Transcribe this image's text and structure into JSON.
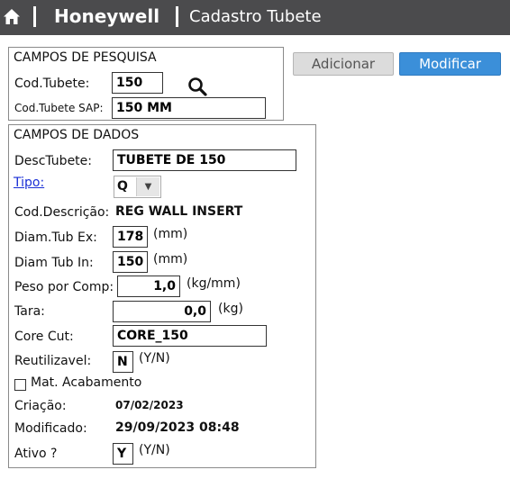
{
  "header": {
    "brand": "Honeywell",
    "title": "Cadastro Tubete",
    "home_icon": "home-icon"
  },
  "toolbar": {
    "add_label": "Adicionar",
    "modify_label": "Modificar"
  },
  "search": {
    "section_title": "CAMPOS DE PESQUISA",
    "cod_tubete_label": "Cod.Tubete:",
    "cod_tubete_value": "150",
    "cod_sap_label": "Cod.Tubete SAP:",
    "cod_sap_value": "150 MM",
    "search_icon": "magnifier-icon"
  },
  "data": {
    "section_title": "CAMPOS DE DADOS",
    "desc_label": "DescTubete:",
    "desc_value": "TUBETE DE 150",
    "tipo_label": "Tipo:",
    "tipo_value": "Q",
    "cod_desc_label": "Cod.Descrição:",
    "cod_desc_value": "REG WALL INSERT",
    "diam_ex_label": "Diam.Tub Ex:",
    "diam_ex_value": "178",
    "diam_ex_unit": "(mm)",
    "diam_in_label": "Diam Tub In:",
    "diam_in_value": "150",
    "diam_in_unit": "(mm)",
    "peso_label": "Peso por Comp:",
    "peso_value": "1,0",
    "peso_unit": "(kg/mm)",
    "tara_label": "Tara:",
    "tara_value": "0,0",
    "tara_unit": "(kg)",
    "core_cut_label": "Core Cut:",
    "core_cut_value": "CORE_150",
    "reutil_label": "Reutilizavel:",
    "reutil_value": "N",
    "reutil_unit": "(Y/N)",
    "mat_acab_label": "Mat. Acabamento",
    "mat_acab_checked": false,
    "criacao_label": "Criação:",
    "criacao_value": "07/02/2023",
    "modificado_label": "Modificado:",
    "modificado_value": "29/09/2023 08:48",
    "ativo_label": "Ativo ?",
    "ativo_value": "Y",
    "ativo_unit": "(Y/N)"
  },
  "colors": {
    "header_bg": "#4b4b4d",
    "primary_button": "#3b8fd9",
    "secondary_button": "#dcdcdc",
    "link": "#1a2fd6"
  }
}
